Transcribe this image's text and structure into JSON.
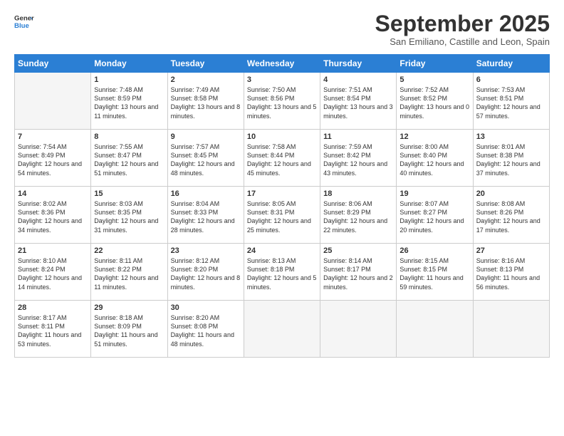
{
  "header": {
    "logo_line1": "General",
    "logo_line2": "Blue",
    "month_title": "September 2025",
    "subtitle": "San Emiliano, Castille and Leon, Spain"
  },
  "days_of_week": [
    "Sunday",
    "Monday",
    "Tuesday",
    "Wednesday",
    "Thursday",
    "Friday",
    "Saturday"
  ],
  "weeks": [
    [
      {
        "day": "",
        "empty": true
      },
      {
        "day": "1",
        "sunrise": "Sunrise: 7:48 AM",
        "sunset": "Sunset: 8:59 PM",
        "daylight": "Daylight: 13 hours and 11 minutes."
      },
      {
        "day": "2",
        "sunrise": "Sunrise: 7:49 AM",
        "sunset": "Sunset: 8:58 PM",
        "daylight": "Daylight: 13 hours and 8 minutes."
      },
      {
        "day": "3",
        "sunrise": "Sunrise: 7:50 AM",
        "sunset": "Sunset: 8:56 PM",
        "daylight": "Daylight: 13 hours and 5 minutes."
      },
      {
        "day": "4",
        "sunrise": "Sunrise: 7:51 AM",
        "sunset": "Sunset: 8:54 PM",
        "daylight": "Daylight: 13 hours and 3 minutes."
      },
      {
        "day": "5",
        "sunrise": "Sunrise: 7:52 AM",
        "sunset": "Sunset: 8:52 PM",
        "daylight": "Daylight: 13 hours and 0 minutes."
      },
      {
        "day": "6",
        "sunrise": "Sunrise: 7:53 AM",
        "sunset": "Sunset: 8:51 PM",
        "daylight": "Daylight: 12 hours and 57 minutes."
      }
    ],
    [
      {
        "day": "7",
        "sunrise": "Sunrise: 7:54 AM",
        "sunset": "Sunset: 8:49 PM",
        "daylight": "Daylight: 12 hours and 54 minutes."
      },
      {
        "day": "8",
        "sunrise": "Sunrise: 7:55 AM",
        "sunset": "Sunset: 8:47 PM",
        "daylight": "Daylight: 12 hours and 51 minutes."
      },
      {
        "day": "9",
        "sunrise": "Sunrise: 7:57 AM",
        "sunset": "Sunset: 8:45 PM",
        "daylight": "Daylight: 12 hours and 48 minutes."
      },
      {
        "day": "10",
        "sunrise": "Sunrise: 7:58 AM",
        "sunset": "Sunset: 8:44 PM",
        "daylight": "Daylight: 12 hours and 45 minutes."
      },
      {
        "day": "11",
        "sunrise": "Sunrise: 7:59 AM",
        "sunset": "Sunset: 8:42 PM",
        "daylight": "Daylight: 12 hours and 43 minutes."
      },
      {
        "day": "12",
        "sunrise": "Sunrise: 8:00 AM",
        "sunset": "Sunset: 8:40 PM",
        "daylight": "Daylight: 12 hours and 40 minutes."
      },
      {
        "day": "13",
        "sunrise": "Sunrise: 8:01 AM",
        "sunset": "Sunset: 8:38 PM",
        "daylight": "Daylight: 12 hours and 37 minutes."
      }
    ],
    [
      {
        "day": "14",
        "sunrise": "Sunrise: 8:02 AM",
        "sunset": "Sunset: 8:36 PM",
        "daylight": "Daylight: 12 hours and 34 minutes."
      },
      {
        "day": "15",
        "sunrise": "Sunrise: 8:03 AM",
        "sunset": "Sunset: 8:35 PM",
        "daylight": "Daylight: 12 hours and 31 minutes."
      },
      {
        "day": "16",
        "sunrise": "Sunrise: 8:04 AM",
        "sunset": "Sunset: 8:33 PM",
        "daylight": "Daylight: 12 hours and 28 minutes."
      },
      {
        "day": "17",
        "sunrise": "Sunrise: 8:05 AM",
        "sunset": "Sunset: 8:31 PM",
        "daylight": "Daylight: 12 hours and 25 minutes."
      },
      {
        "day": "18",
        "sunrise": "Sunrise: 8:06 AM",
        "sunset": "Sunset: 8:29 PM",
        "daylight": "Daylight: 12 hours and 22 minutes."
      },
      {
        "day": "19",
        "sunrise": "Sunrise: 8:07 AM",
        "sunset": "Sunset: 8:27 PM",
        "daylight": "Daylight: 12 hours and 20 minutes."
      },
      {
        "day": "20",
        "sunrise": "Sunrise: 8:08 AM",
        "sunset": "Sunset: 8:26 PM",
        "daylight": "Daylight: 12 hours and 17 minutes."
      }
    ],
    [
      {
        "day": "21",
        "sunrise": "Sunrise: 8:10 AM",
        "sunset": "Sunset: 8:24 PM",
        "daylight": "Daylight: 12 hours and 14 minutes."
      },
      {
        "day": "22",
        "sunrise": "Sunrise: 8:11 AM",
        "sunset": "Sunset: 8:22 PM",
        "daylight": "Daylight: 12 hours and 11 minutes."
      },
      {
        "day": "23",
        "sunrise": "Sunrise: 8:12 AM",
        "sunset": "Sunset: 8:20 PM",
        "daylight": "Daylight: 12 hours and 8 minutes."
      },
      {
        "day": "24",
        "sunrise": "Sunrise: 8:13 AM",
        "sunset": "Sunset: 8:18 PM",
        "daylight": "Daylight: 12 hours and 5 minutes."
      },
      {
        "day": "25",
        "sunrise": "Sunrise: 8:14 AM",
        "sunset": "Sunset: 8:17 PM",
        "daylight": "Daylight: 12 hours and 2 minutes."
      },
      {
        "day": "26",
        "sunrise": "Sunrise: 8:15 AM",
        "sunset": "Sunset: 8:15 PM",
        "daylight": "Daylight: 11 hours and 59 minutes."
      },
      {
        "day": "27",
        "sunrise": "Sunrise: 8:16 AM",
        "sunset": "Sunset: 8:13 PM",
        "daylight": "Daylight: 11 hours and 56 minutes."
      }
    ],
    [
      {
        "day": "28",
        "sunrise": "Sunrise: 8:17 AM",
        "sunset": "Sunset: 8:11 PM",
        "daylight": "Daylight: 11 hours and 53 minutes."
      },
      {
        "day": "29",
        "sunrise": "Sunrise: 8:18 AM",
        "sunset": "Sunset: 8:09 PM",
        "daylight": "Daylight: 11 hours and 51 minutes."
      },
      {
        "day": "30",
        "sunrise": "Sunrise: 8:20 AM",
        "sunset": "Sunset: 8:08 PM",
        "daylight": "Daylight: 11 hours and 48 minutes."
      },
      {
        "day": "",
        "empty": true
      },
      {
        "day": "",
        "empty": true
      },
      {
        "day": "",
        "empty": true
      },
      {
        "day": "",
        "empty": true
      }
    ]
  ]
}
